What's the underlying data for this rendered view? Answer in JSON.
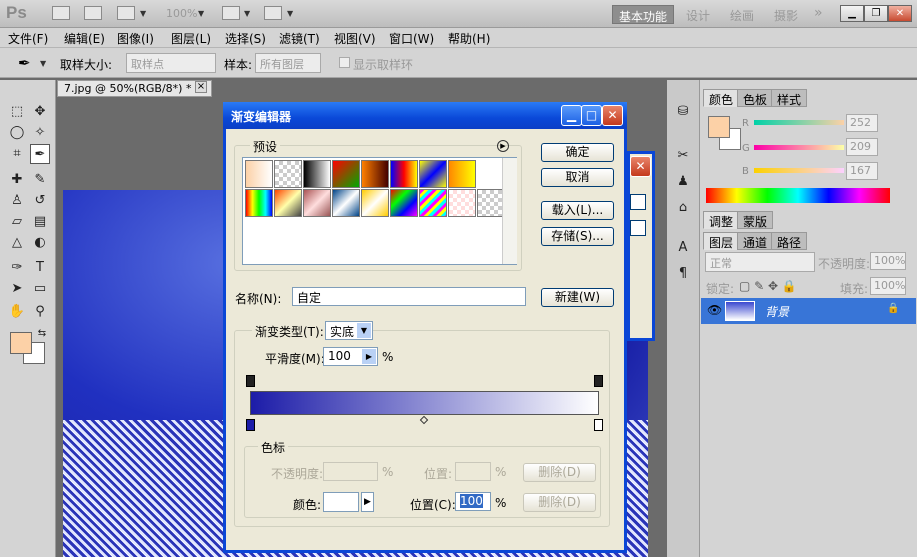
{
  "app": {
    "logo": "Ps",
    "zoom": "100%"
  },
  "workspaces": [
    "基本功能",
    "设计",
    "绘画",
    "摄影"
  ],
  "more": "»",
  "menus": [
    "文件(F)",
    "编辑(E)",
    "图像(I)",
    "图层(L)",
    "选择(S)",
    "滤镜(T)",
    "视图(V)",
    "窗口(W)",
    "帮助(H)"
  ],
  "options": {
    "sample_size_label": "取样大小:",
    "sample_size_value": "取样点",
    "sample_label": "样本:",
    "sample_value": "所有图层",
    "show_ring": "显示取样环"
  },
  "document": {
    "tab": "7.jpg @ 50%(RGB/8*) *",
    "close": "×"
  },
  "color_panel": {
    "tabs": [
      "颜色",
      "色板",
      "样式"
    ],
    "channels": [
      {
        "name": "R",
        "value": "252"
      },
      {
        "name": "G",
        "value": "209"
      },
      {
        "name": "B",
        "value": "167"
      }
    ],
    "fg": "#fcd1a7",
    "bg": "#ffffff"
  },
  "adjust_tabs": [
    "调整",
    "蒙版"
  ],
  "layers_panel": {
    "tabs": [
      "图层",
      "通道",
      "路径"
    ],
    "blend_mode": "正常",
    "opacity_label": "不透明度:",
    "opacity_value": "100%",
    "lock_label": "锁定:",
    "fill_label": "填充:",
    "fill_value": "100%",
    "layer_name": "背景"
  },
  "dialog": {
    "title": "渐变编辑器",
    "presets_label": "预设",
    "buttons": {
      "ok": "确定",
      "cancel": "取消",
      "load": "载入(L)...",
      "save": "存储(S)...",
      "new": "新建(W)"
    },
    "name_label": "名称(N):",
    "name_value": "自定",
    "type_label": "渐变类型(T):",
    "type_value": "实底",
    "smooth_label": "平滑度(M):",
    "smooth_value": "100",
    "smooth_unit": "%",
    "stops_group": "色标",
    "opacity_label": "不透明度:",
    "opacity_unit": "%",
    "location_label": "位置:",
    "location_unit": "%",
    "delete_label": "删除(D)",
    "color_label": "颜色:",
    "color_location_label": "位置(C):",
    "color_location_value": "100",
    "color_location_unit": "%",
    "delete2_label": "删除(D)",
    "gradient_start": "#1c1ca8",
    "gradient_end": "#ffffff"
  }
}
